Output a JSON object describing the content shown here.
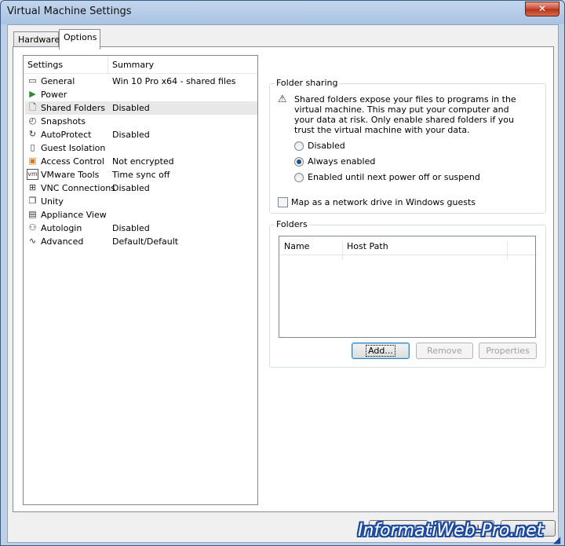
{
  "window": {
    "title": "Virtual Machine Settings",
    "close_glyph": "✕"
  },
  "tabs": [
    {
      "label": "Hardware",
      "active": false
    },
    {
      "label": "Options",
      "active": true
    }
  ],
  "settings_list": {
    "columns": [
      "Settings",
      "Summary"
    ],
    "items": [
      {
        "name": "General",
        "summary": "Win 10 Pro x64 - shared files",
        "icon": "general-icon",
        "glyph": "▭"
      },
      {
        "name": "Power",
        "summary": "",
        "icon": "power-icon",
        "glyph": "▶",
        "color": "#2e8b2e"
      },
      {
        "name": "Shared Folders",
        "summary": "Disabled",
        "icon": "shared-folders-icon",
        "glyph": "🗋",
        "selected": true
      },
      {
        "name": "Snapshots",
        "summary": "",
        "icon": "snapshots-icon",
        "glyph": "◴"
      },
      {
        "name": "AutoProtect",
        "summary": "Disabled",
        "icon": "autoprotect-icon",
        "glyph": "↻"
      },
      {
        "name": "Guest Isolation",
        "summary": "",
        "icon": "guest-isolation-icon",
        "glyph": "▯"
      },
      {
        "name": "Access Control",
        "summary": "Not encrypted",
        "icon": "access-control-icon",
        "glyph": "▣",
        "color": "#e07a10"
      },
      {
        "name": "VMware Tools",
        "summary": "Time sync off",
        "icon": "vmware-tools-icon",
        "glyph": "vm"
      },
      {
        "name": "VNC Connections",
        "summary": "Disabled",
        "icon": "vnc-connections-icon",
        "glyph": "⊞"
      },
      {
        "name": "Unity",
        "summary": "",
        "icon": "unity-icon",
        "glyph": "❐"
      },
      {
        "name": "Appliance View",
        "summary": "",
        "icon": "appliance-view-icon",
        "glyph": "▤"
      },
      {
        "name": "Autologin",
        "summary": "Disabled",
        "icon": "autologin-icon",
        "glyph": "⚇"
      },
      {
        "name": "Advanced",
        "summary": "Default/Default",
        "icon": "advanced-icon",
        "glyph": "∿"
      }
    ]
  },
  "folder_sharing": {
    "label": "Folder sharing",
    "warning_icon": "warning-icon",
    "warning_glyph": "⚠",
    "warning_text": "Shared folders expose your files to programs in the virtual machine. This may put your computer and your data at risk. Only enable shared folders if you trust the virtual machine with your data.",
    "options": [
      {
        "label": "Disabled",
        "selected": false
      },
      {
        "label": "Always enabled",
        "selected": true
      },
      {
        "label": "Enabled until next power off or suspend",
        "selected": false
      }
    ],
    "map_drive_label": "Map as a network drive in Windows guests",
    "map_drive_checked": false
  },
  "folders": {
    "label": "Folders",
    "columns": [
      "Name",
      "Host Path"
    ],
    "rows": [],
    "add_label": "Add...",
    "remove_label": "Remove",
    "properties_label": "Properties"
  },
  "footer": {
    "ok_label": "OK",
    "cancel_label": "Cancel",
    "help_label": "Help"
  },
  "watermark": "InformatiWeb-Pro.net"
}
